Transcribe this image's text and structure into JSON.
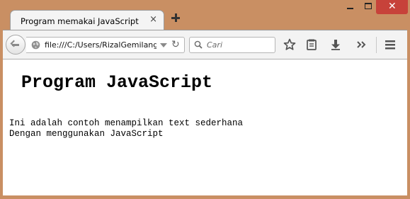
{
  "browser": {
    "tab": {
      "title": "Program memakai JavaScript",
      "close_glyph": "×"
    },
    "new_tab_icon": "plus-icon",
    "window_controls": {
      "close_glyph": "✕",
      "close_color": "#c7423a"
    },
    "urlbar": {
      "url": "file:///C:/Users/RizalGemilang",
      "icon": "globe-icon"
    },
    "reload_glyph": "↻",
    "search": {
      "placeholder": "Cari"
    },
    "toolbar_icons": [
      "bookmark-star-icon",
      "reading-list-icon",
      "download-icon",
      "overflow-chevron-icon",
      "hamburger-menu-icon"
    ],
    "frame_color": "#c98f63"
  },
  "page": {
    "heading": "Program JavaScript",
    "lines": [
      "Ini adalah contoh menampilkan text sederhana",
      "Dengan menggunakan JavaScript"
    ]
  }
}
